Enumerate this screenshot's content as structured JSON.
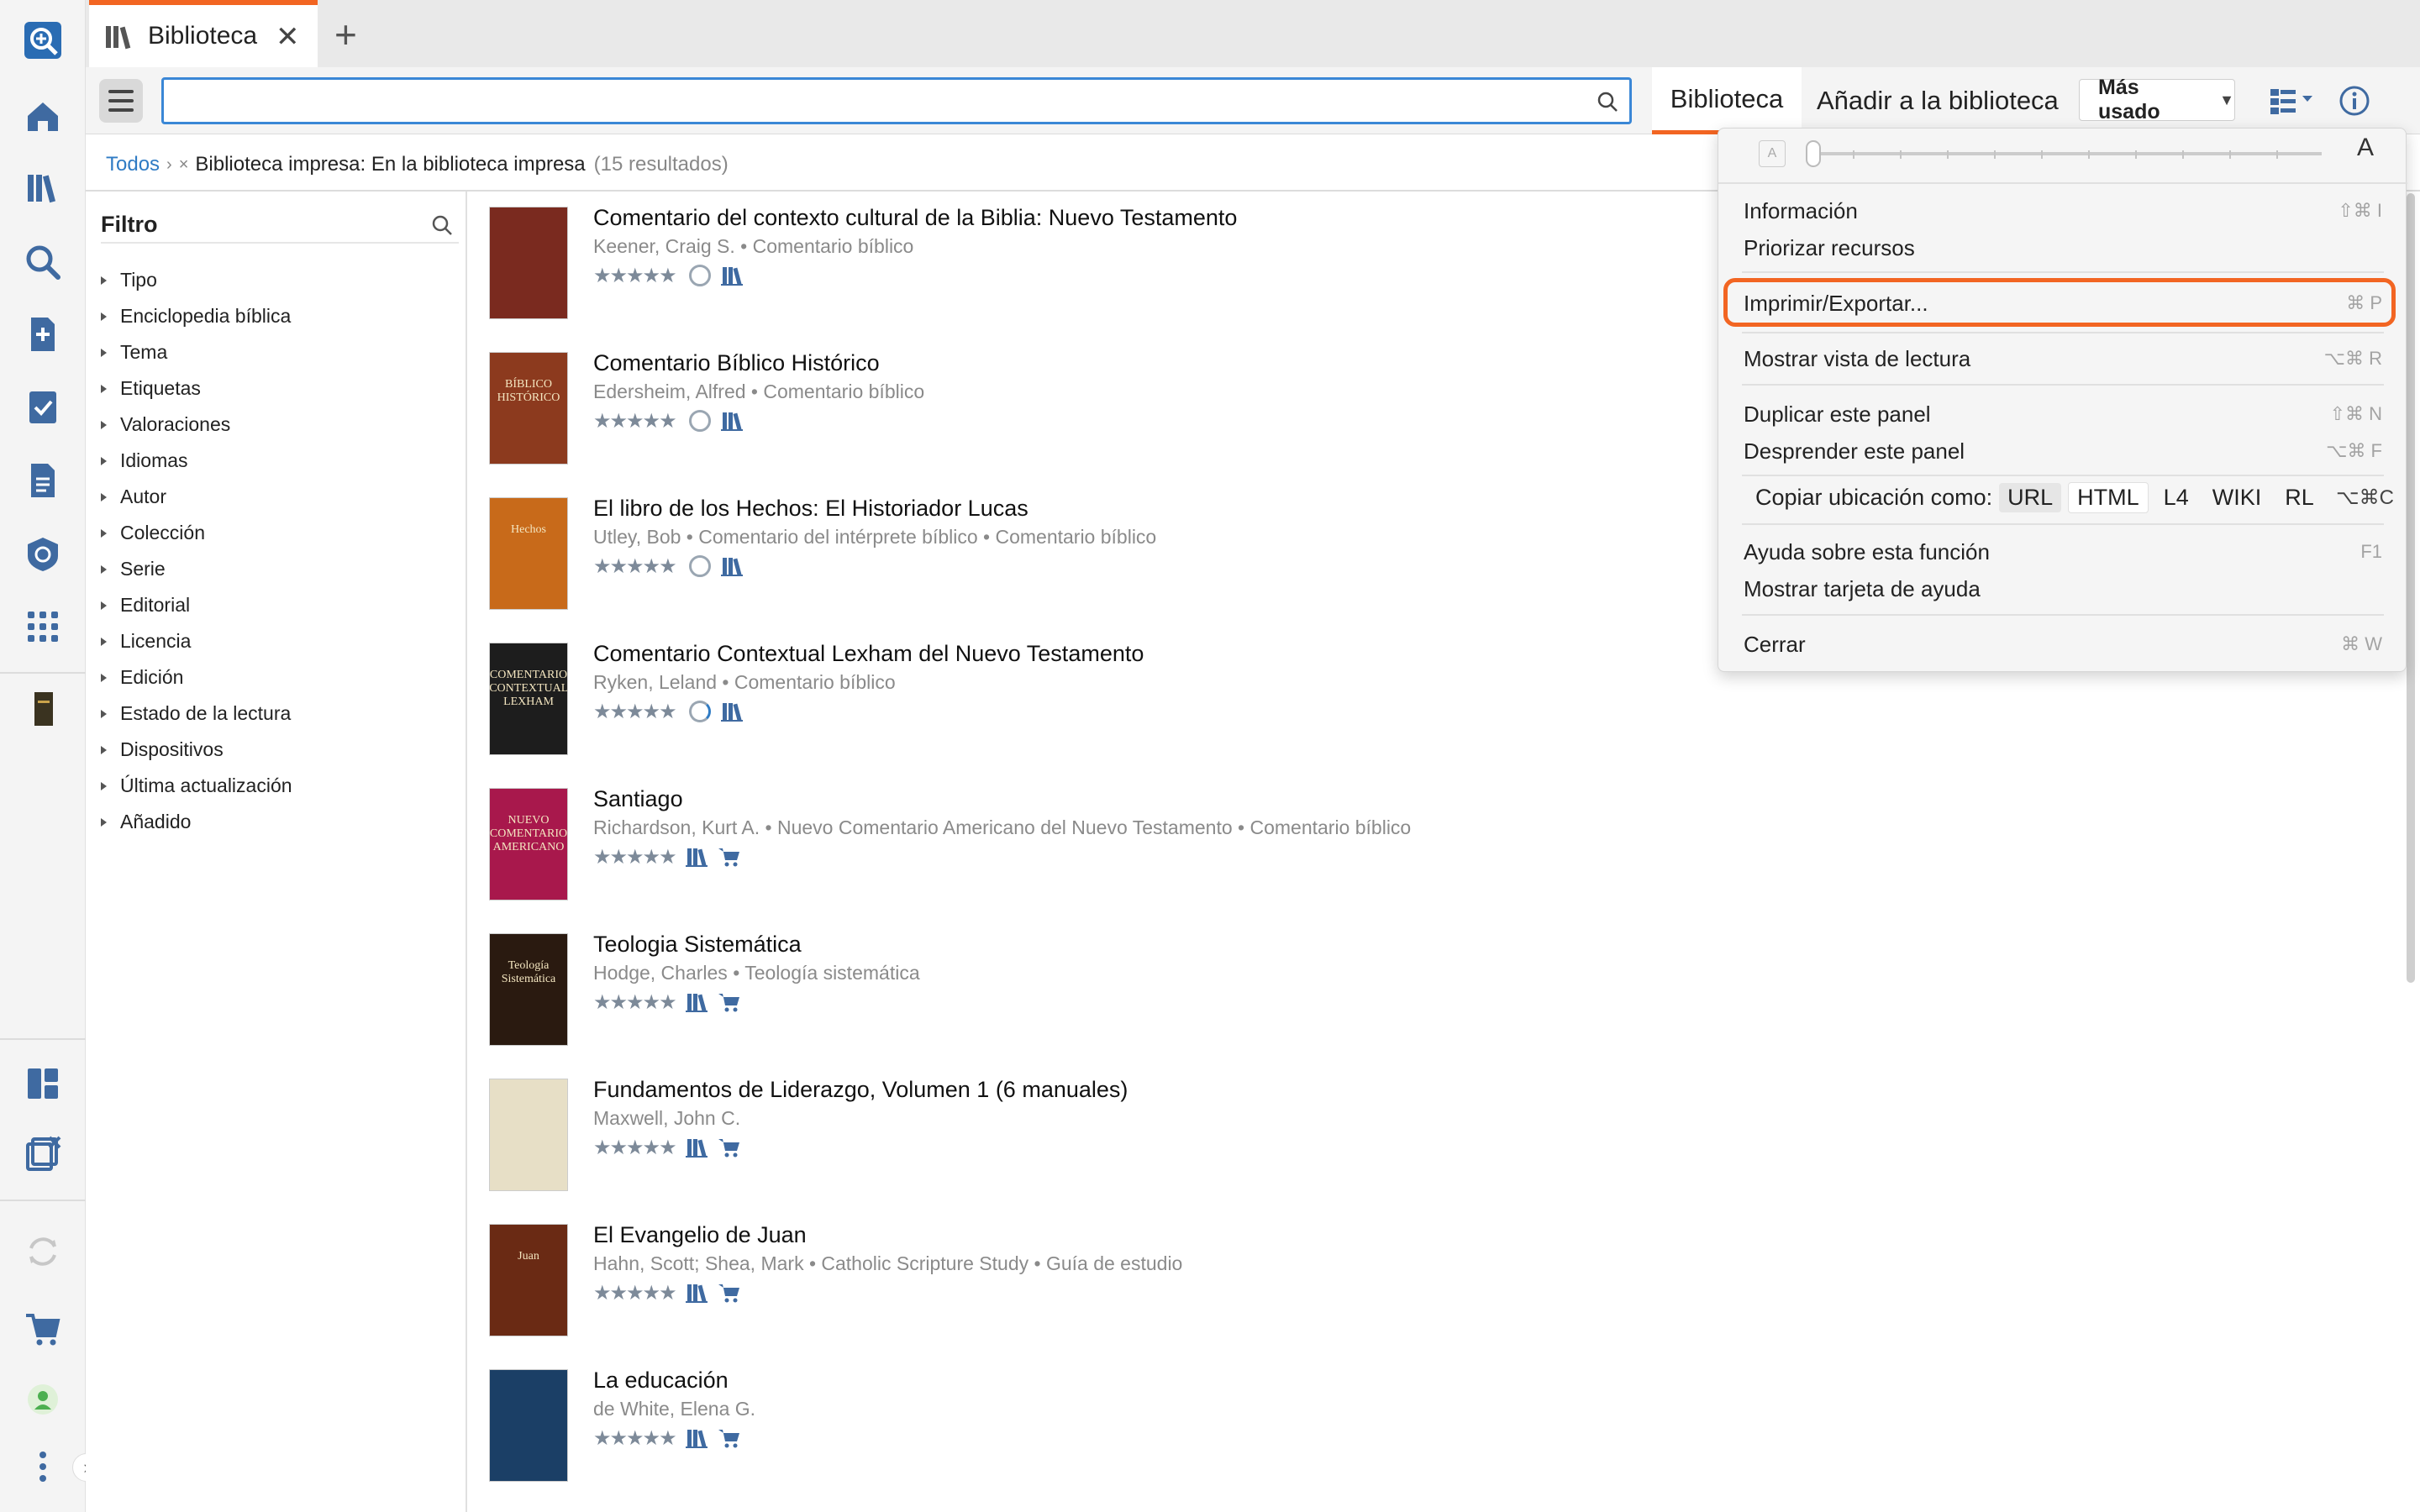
{
  "window": {
    "tab_title": "Biblioteca",
    "tab_close": "✕",
    "new_tab": "+"
  },
  "toolbar": {
    "search_placeholder": "",
    "tab_library": "Biblioteca",
    "tab_add": "Añadir a la biblioteca",
    "sort_label": "Más usado"
  },
  "breadcrumb": {
    "all": "Todos",
    "sep": "›",
    "remove": "×",
    "current": "Biblioteca impresa: En la biblioteca impresa",
    "count": "(15 resultados)"
  },
  "filter": {
    "title": "Filtro",
    "items": [
      "Tipo",
      "Enciclopedia bíblica",
      "Tema",
      "Etiquetas",
      "Valoraciones",
      "Idiomas",
      "Autor",
      "Colección",
      "Serie",
      "Editorial",
      "Licencia",
      "Edición",
      "Estado de la lectura",
      "Dispositivos",
      "Última actualización",
      "Añadido"
    ]
  },
  "results": [
    {
      "title": "Comentario del contexto cultural de la Biblia: Nuevo Testamento",
      "meta": "Keener, Craig S. • Comentario bíblico",
      "stars": "★★★★★",
      "cover_color": "#7a2a1f",
      "cover_text": ""
    },
    {
      "title": "Comentario Bíblico Histórico",
      "meta": "Edersheim, Alfred • Comentario bíblico",
      "stars": "★★★★★",
      "cover_color": "#8c3a1e",
      "cover_text": "BÍBLICO HISTÓRICO"
    },
    {
      "title": "El libro de los Hechos: El Historiador Lucas",
      "meta": "Utley, Bob • Comentario del intérprete bíblico • Comentario bíblico",
      "stars": "★★★★★",
      "cover_color": "#c86a1a",
      "cover_text": "Hechos"
    },
    {
      "title": "Comentario Contextual Lexham del Nuevo Testamento",
      "meta": "Ryken, Leland • Comentario bíblico",
      "stars": "★★★★★",
      "cover_color": "#1d1d1d",
      "cover_text": "COMENTARIO CONTEXTUAL LEXHAM"
    },
    {
      "title": "Santiago",
      "meta": "Richardson, Kurt A. • Nuevo Comentario Americano del Nuevo Testamento • Comentario bíblico",
      "stars": "★★★★★",
      "cover_color": "#a8184c",
      "cover_text": "NUEVO COMENTARIO AMERICANO"
    },
    {
      "title": "Teologia Sistemática",
      "meta": "Hodge, Charles • Teología sistemática",
      "stars": "★★★★★",
      "cover_color": "#2a1a10",
      "cover_text": "Teología Sistemática"
    },
    {
      "title": "Fundamentos de Liderazgo, Volumen 1 (6 manuales)",
      "meta": "Maxwell, John C.",
      "stars": "★★★★★",
      "cover_color": "#e7dfc6",
      "cover_text": ""
    },
    {
      "title": "El Evangelio de Juan",
      "meta": "Hahn, Scott; Shea, Mark • Catholic Scripture Study • Guía de estudio",
      "stars": "★★★★★",
      "cover_color": "#6a2a14",
      "cover_text": "Juan"
    },
    {
      "title": "La educación",
      "meta": "de White, Elena G.",
      "stars": "★★★★★",
      "cover_color": "#1b3f66",
      "cover_text": ""
    }
  ],
  "menu": {
    "font_small": "A",
    "font_large": "A",
    "items": [
      {
        "label": "Información",
        "shortcut": "⇧⌘ I"
      },
      {
        "label": "Priorizar recursos",
        "shortcut": ""
      },
      {
        "label": "Imprimir/Exportar...",
        "shortcut": "⌘ P"
      },
      {
        "label": "Mostrar vista de lectura",
        "shortcut": "⌥⌘ R"
      },
      {
        "label": "Duplicar este panel",
        "shortcut": "⇧⌘ N"
      },
      {
        "label": "Desprender este panel",
        "shortcut": "⌥⌘ F"
      },
      {
        "label": "Ayuda sobre esta función",
        "shortcut": "F1"
      },
      {
        "label": "Mostrar tarjeta de ayuda",
        "shortcut": ""
      },
      {
        "label": "Cerrar",
        "shortcut": "⌘ W"
      }
    ],
    "copy": {
      "label": "Copiar ubicación como:",
      "formats": [
        "URL",
        "HTML",
        "L4",
        "WIKI",
        "RL"
      ],
      "shortcut": "⌥⌘C"
    }
  },
  "colors": {
    "accent": "#f26522",
    "link": "#2f7bc4",
    "icon": "#3f6aa1"
  }
}
